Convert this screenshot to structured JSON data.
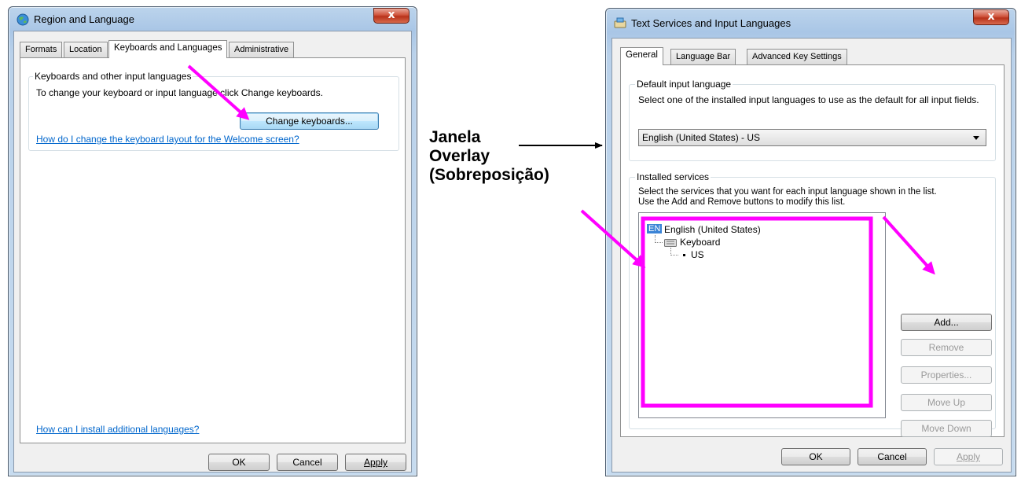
{
  "left_window": {
    "title": "Region and Language",
    "close_glyph": "x",
    "tabs": [
      "Formats",
      "Location",
      "Keyboards and Languages",
      "Administrative"
    ],
    "group_title": "Keyboards and other input languages",
    "instruction": "To change your keyboard or input language click Change keyboards.",
    "change_keyboards_button": "Change keyboards...",
    "welcome_link": "How do I change the keyboard layout for the Welcome screen?",
    "install_link": "How can I install additional languages?",
    "buttons": {
      "ok": "OK",
      "cancel": "Cancel",
      "apply": "Apply"
    }
  },
  "annotation": {
    "line1": "Janela",
    "line2": "Overlay",
    "line3": "(Sobreposição)",
    "highlight_color": "#ff00ff"
  },
  "right_window": {
    "title": "Text Services and Input Languages",
    "close_glyph": "x",
    "tabs": [
      "General",
      "Language Bar",
      "Advanced Key Settings"
    ],
    "default_group_title": "Default input language",
    "default_description": "Select one of the installed input languages to use as the default for all input fields.",
    "default_selected": "English (United States) - US",
    "services_group_title": "Installed services",
    "services_description_1": "Select the services that you want for each input language shown in the list.",
    "services_description_2": "Use the Add and Remove buttons to modify this list.",
    "tree": {
      "language_badge": "EN",
      "language": "English (United States)",
      "category": "Keyboard",
      "layout": "US"
    },
    "side_buttons": {
      "add": "Add...",
      "remove": "Remove",
      "properties": "Properties...",
      "move_up": "Move Up",
      "move_down": "Move Down"
    },
    "buttons": {
      "ok": "OK",
      "cancel": "Cancel",
      "apply": "Apply"
    }
  }
}
